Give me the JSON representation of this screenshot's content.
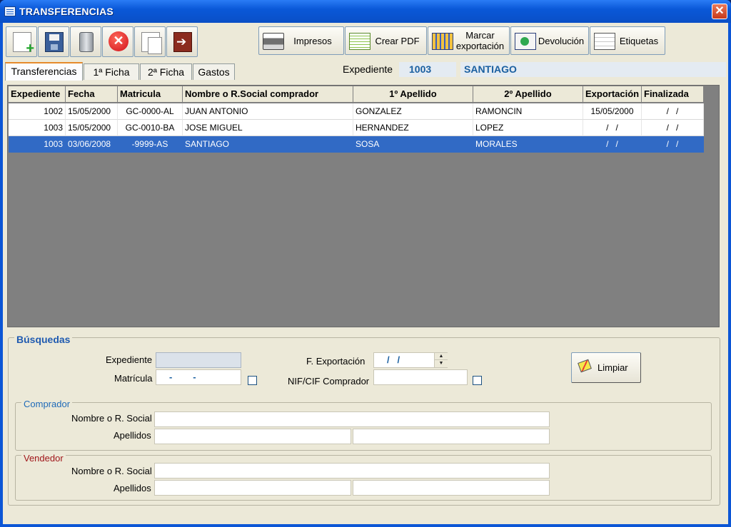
{
  "window": {
    "title": "TRANSFERENCIAS",
    "accent": "#0a58d8",
    "selection": "#316ac5"
  },
  "toolbar": {
    "icons": [
      "new-document-icon",
      "save-icon",
      "trash-icon",
      "cancel-icon",
      "copy-icon",
      "exit-icon"
    ],
    "actions": [
      {
        "label": "Impresos",
        "icon": "printer-icon"
      },
      {
        "label": "Crear PDF",
        "icon": "pdf-document-icon"
      },
      {
        "label": "Marcar\nexportación",
        "icon": "mark-export-icon"
      },
      {
        "label": "Devolución",
        "icon": "return-icon"
      },
      {
        "label": "Etiquetas",
        "icon": "labels-printer-icon"
      }
    ]
  },
  "tabs": [
    "Transferencias",
    "1ª Ficha",
    "2ª Ficha",
    "Gastos"
  ],
  "active_tab": "Transferencias",
  "expediente": {
    "label": "Expediente",
    "number": "1003",
    "name": "SANTIAGO"
  },
  "grid": {
    "columns": [
      "Expediente",
      "Fecha",
      "Matricula",
      "Nombre o R.Social comprador",
      "1º Apellido",
      "2º Apellido",
      "Exportación",
      "Finalizada"
    ],
    "rows": [
      [
        "1002",
        "15/05/2000",
        "GC-0000-AL",
        "JUAN ANTONIO",
        "GONZALEZ",
        "RAMONCIN",
        "15/05/2000",
        "/   /"
      ],
      [
        "1003",
        "15/05/2000",
        "GC-0010-BA",
        "JOSE MIGUEL",
        "HERNANDEZ",
        "LOPEZ",
        "/   /",
        "/   /"
      ],
      [
        "1003",
        "03/06/2008",
        "-9999-AS",
        "SANTIAGO",
        "SOSA",
        "MORALES",
        "/   /",
        "/   /"
      ]
    ],
    "selected_row": 2
  },
  "busquedas": {
    "title": "Búsquedas",
    "expediente_label": "Expediente",
    "expediente_value": "",
    "matricula_label": "Matrícula",
    "matricula_value": "-        -",
    "fexport_label": "F. Exportación",
    "fexport_value": "/   /",
    "nif_label": "NIF/CIF Comprador",
    "nif_value": "",
    "limpiar_label": "Limpiar",
    "comprador": {
      "title": "Comprador",
      "nombre_label": "Nombre o R. Social",
      "apellidos_label": "Apellidos",
      "title_color": "#1f6ab8"
    },
    "vendedor": {
      "title": "Vendedor",
      "nombre_label": "Nombre o R. Social",
      "apellidos_label": "Apellidos",
      "title_color": "#a0161a"
    }
  }
}
